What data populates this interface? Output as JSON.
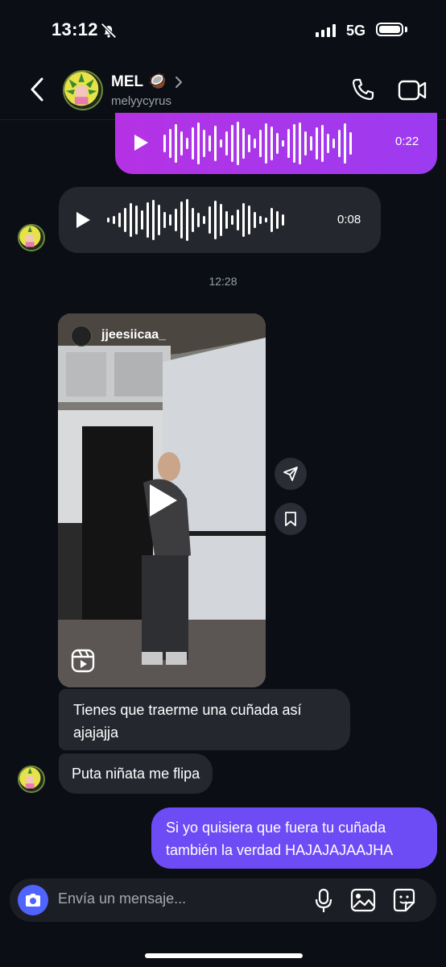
{
  "status_bar": {
    "time": "13:12",
    "network": "5G"
  },
  "header": {
    "name": "MEL",
    "name_emoji": "🥥",
    "username": "melyycyrus"
  },
  "messages": {
    "voice_sent_duration": "0:22",
    "voice_received_duration": "0:08",
    "timestamp": "12:28",
    "reel_username": "jjeesiicaa_",
    "text_received_1": "Tienes que traerme una cuñada así ajajajja",
    "text_received_2": "Puta niñata me flipa",
    "text_sent": "Si yo quisiera que fuera tu cuñada también la verdad HAJAJAJAAJHA"
  },
  "composer": {
    "placeholder": "Envía un mensaje..."
  },
  "icons": [
    "back-icon",
    "chevron-right-icon",
    "phone-icon",
    "video-call-icon",
    "play-icon",
    "share-icon",
    "bookmark-icon",
    "reels-icon",
    "camera-icon",
    "microphone-icon",
    "gallery-icon",
    "sticker-icon"
  ],
  "colors": {
    "sent_voice": "#b532e4",
    "sent_text": "#6d4cf6",
    "received": "#25272f",
    "camera": "#4f63ff",
    "background": "#0c0e16"
  }
}
